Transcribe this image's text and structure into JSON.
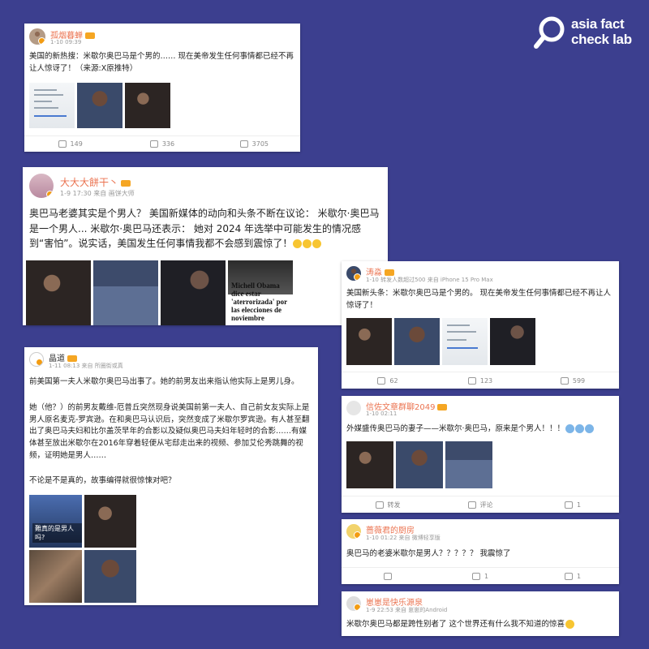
{
  "brand": {
    "logo_line1": "asia fact",
    "logo_line2": "check lab"
  },
  "posts": [
    {
      "username": "孤烟暮蝉",
      "meta": "1-10 09:39",
      "text": "美国的新热搜：米歇尔奥巴马是个男的…… 现在美帝发生任何事情都已经不再让人惊讶了！（来源:X原推特）",
      "reposts": "149",
      "comments": "336",
      "likes": "3705"
    },
    {
      "username": "大大大餅干丶",
      "meta": "1-9 17:30 来自 画饼大师",
      "text": "奥巴马老婆其实是个男人？ 美国新媒体的动向和头条不断在议论： 米歇尔·奥巴马是一个男人... 米歇尔·奥巴马还表示： 她对 2024 年选举中可能发生的情况感到“害怕”。说实话，美国发生任何事情我都不会感到震惊了！",
      "news_caption": "Michell Obama dice estar 'aterrorizada' por las elecciones de noviembre"
    },
    {
      "username": "涛淼",
      "meta": "1-10 转发人数超过500 来自 iPhone 15 Pro Max",
      "text": "美国新头条：米歇尔奥巴马是个男的。 现在美帝发生任何事情都已经不再让人惊讶了！",
      "reposts": "62",
      "comments": "123",
      "likes": "599"
    },
    {
      "username": "晶道",
      "meta": "1-11 08:13 来自 所圈街或真",
      "p1": "前美国第一夫人米歇尔奥巴马出事了。她的前男友出来指认他实际上是男儿身。",
      "p2": "她（他？）的前男友戴维-厄普丘突然现身说美国前第一夫人、自己前女友实际上是男人原名麦克-罗宾逊。在和奥巴马认识后，突然变成了米歇尔罗宾逊。有人甚至翻出了奥巴马夫妇和比尔盖茨早年的合影以及疑似奥巴马夫妇年轻时的合影……有媒体甚至放出米歇尔在2016年穿着轻便从宅邸走出来的视频、参加艾伦秀跳舞的视频，证明她是男人……",
      "p3": "不论是不是真的，故事编得就很惊悚对吧？",
      "img_caption": "難真的是男人吗?"
    },
    {
      "username": "信佐文章群聊2049",
      "meta": "1-10 02:11",
      "text": "外媒盛传奥巴马的妻子——米歇尔·奥巴马，原来是个男人！！！",
      "repost_label": "转发",
      "comment_label": "评论",
      "likes": "1"
    },
    {
      "username": "蔷薇君的厨房",
      "meta": "1-10 01:22 来自 微博轻享版",
      "text": "奥巴马的老婆米歇尔是男人？？？？？ 我震惊了",
      "comments": "1",
      "likes": "1"
    },
    {
      "username": "崽崽是快乐源泉",
      "meta": "1-9 22:53 来自 崽崽的Android",
      "text": "米歇尔奥巴马都是跨性别者了 这个世界还有什么我不知道的惊喜"
    }
  ]
}
